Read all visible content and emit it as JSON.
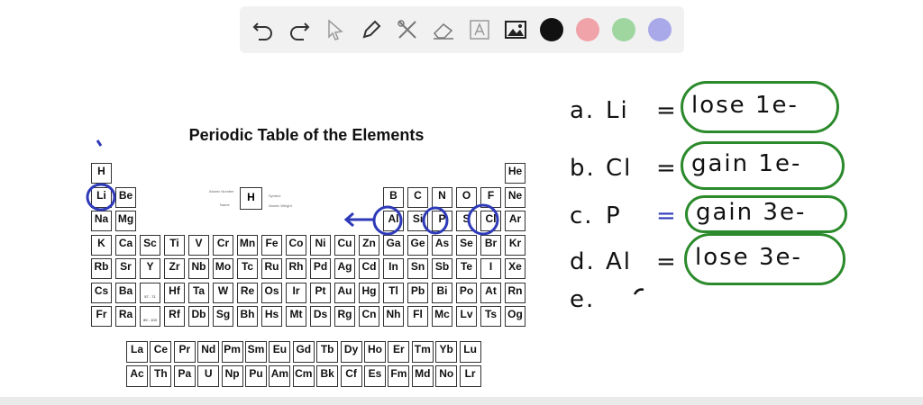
{
  "toolbar": {
    "tools": [
      "undo-icon",
      "redo-icon",
      "pointer-icon",
      "pen-icon",
      "tools-icon",
      "eraser-icon",
      "text-icon",
      "image-icon"
    ],
    "colors": [
      "#111111",
      "#f0a3a8",
      "#9fd6a0",
      "#a9a9ea"
    ]
  },
  "table": {
    "title": "Periodic Table of the Elements",
    "key": {
      "symbol": "H",
      "notes": [
        "Atomic Number",
        "Name",
        "Symbol",
        "Atomic Weight"
      ]
    },
    "elements": [
      {
        "s": "H",
        "r": 0,
        "c": 0
      },
      {
        "s": "He",
        "r": 0,
        "c": 17
      },
      {
        "s": "Li",
        "r": 1,
        "c": 0
      },
      {
        "s": "Be",
        "r": 1,
        "c": 1
      },
      {
        "s": "B",
        "r": 1,
        "c": 12
      },
      {
        "s": "C",
        "r": 1,
        "c": 13
      },
      {
        "s": "N",
        "r": 1,
        "c": 14
      },
      {
        "s": "O",
        "r": 1,
        "c": 15
      },
      {
        "s": "F",
        "r": 1,
        "c": 16
      },
      {
        "s": "Ne",
        "r": 1,
        "c": 17
      },
      {
        "s": "Na",
        "r": 2,
        "c": 0
      },
      {
        "s": "Mg",
        "r": 2,
        "c": 1
      },
      {
        "s": "Al",
        "r": 2,
        "c": 12
      },
      {
        "s": "Si",
        "r": 2,
        "c": 13
      },
      {
        "s": "P",
        "r": 2,
        "c": 14
      },
      {
        "s": "S",
        "r": 2,
        "c": 15
      },
      {
        "s": "Cl",
        "r": 2,
        "c": 16
      },
      {
        "s": "Ar",
        "r": 2,
        "c": 17
      },
      {
        "s": "K",
        "r": 3,
        "c": 0
      },
      {
        "s": "Ca",
        "r": 3,
        "c": 1
      },
      {
        "s": "Sc",
        "r": 3,
        "c": 2
      },
      {
        "s": "Ti",
        "r": 3,
        "c": 3
      },
      {
        "s": "V",
        "r": 3,
        "c": 4
      },
      {
        "s": "Cr",
        "r": 3,
        "c": 5
      },
      {
        "s": "Mn",
        "r": 3,
        "c": 6
      },
      {
        "s": "Fe",
        "r": 3,
        "c": 7
      },
      {
        "s": "Co",
        "r": 3,
        "c": 8
      },
      {
        "s": "Ni",
        "r": 3,
        "c": 9
      },
      {
        "s": "Cu",
        "r": 3,
        "c": 10
      },
      {
        "s": "Zn",
        "r": 3,
        "c": 11
      },
      {
        "s": "Ga",
        "r": 3,
        "c": 12
      },
      {
        "s": "Ge",
        "r": 3,
        "c": 13
      },
      {
        "s": "As",
        "r": 3,
        "c": 14
      },
      {
        "s": "Se",
        "r": 3,
        "c": 15
      },
      {
        "s": "Br",
        "r": 3,
        "c": 16
      },
      {
        "s": "Kr",
        "r": 3,
        "c": 17
      },
      {
        "s": "Rb",
        "r": 4,
        "c": 0
      },
      {
        "s": "Sr",
        "r": 4,
        "c": 1
      },
      {
        "s": "Y",
        "r": 4,
        "c": 2
      },
      {
        "s": "Zr",
        "r": 4,
        "c": 3
      },
      {
        "s": "Nb",
        "r": 4,
        "c": 4
      },
      {
        "s": "Mo",
        "r": 4,
        "c": 5
      },
      {
        "s": "Tc",
        "r": 4,
        "c": 6
      },
      {
        "s": "Ru",
        "r": 4,
        "c": 7
      },
      {
        "s": "Rh",
        "r": 4,
        "c": 8
      },
      {
        "s": "Pd",
        "r": 4,
        "c": 9
      },
      {
        "s": "Ag",
        "r": 4,
        "c": 10
      },
      {
        "s": "Cd",
        "r": 4,
        "c": 11
      },
      {
        "s": "In",
        "r": 4,
        "c": 12
      },
      {
        "s": "Sn",
        "r": 4,
        "c": 13
      },
      {
        "s": "Sb",
        "r": 4,
        "c": 14
      },
      {
        "s": "Te",
        "r": 4,
        "c": 15
      },
      {
        "s": "I",
        "r": 4,
        "c": 16
      },
      {
        "s": "Xe",
        "r": 4,
        "c": 17
      },
      {
        "s": "Cs",
        "r": 5,
        "c": 0
      },
      {
        "s": "Ba",
        "r": 5,
        "c": 1
      },
      {
        "s": "57 - 71",
        "r": 5,
        "c": 2
      },
      {
        "s": "Hf",
        "r": 5,
        "c": 3
      },
      {
        "s": "Ta",
        "r": 5,
        "c": 4
      },
      {
        "s": "W",
        "r": 5,
        "c": 5
      },
      {
        "s": "Re",
        "r": 5,
        "c": 6
      },
      {
        "s": "Os",
        "r": 5,
        "c": 7
      },
      {
        "s": "Ir",
        "r": 5,
        "c": 8
      },
      {
        "s": "Pt",
        "r": 5,
        "c": 9
      },
      {
        "s": "Au",
        "r": 5,
        "c": 10
      },
      {
        "s": "Hg",
        "r": 5,
        "c": 11
      },
      {
        "s": "Tl",
        "r": 5,
        "c": 12
      },
      {
        "s": "Pb",
        "r": 5,
        "c": 13
      },
      {
        "s": "Bi",
        "r": 5,
        "c": 14
      },
      {
        "s": "Po",
        "r": 5,
        "c": 15
      },
      {
        "s": "At",
        "r": 5,
        "c": 16
      },
      {
        "s": "Rn",
        "r": 5,
        "c": 17
      },
      {
        "s": "Fr",
        "r": 6,
        "c": 0
      },
      {
        "s": "Ra",
        "r": 6,
        "c": 1
      },
      {
        "s": "89 - 103",
        "r": 6,
        "c": 2
      },
      {
        "s": "Rf",
        "r": 6,
        "c": 3
      },
      {
        "s": "Db",
        "r": 6,
        "c": 4
      },
      {
        "s": "Sg",
        "r": 6,
        "c": 5
      },
      {
        "s": "Bh",
        "r": 6,
        "c": 6
      },
      {
        "s": "Hs",
        "r": 6,
        "c": 7
      },
      {
        "s": "Mt",
        "r": 6,
        "c": 8
      },
      {
        "s": "Ds",
        "r": 6,
        "c": 9
      },
      {
        "s": "Rg",
        "r": 6,
        "c": 10
      },
      {
        "s": "Cn",
        "r": 6,
        "c": 11
      },
      {
        "s": "Nh",
        "r": 6,
        "c": 12
      },
      {
        "s": "Fl",
        "r": 6,
        "c": 13
      },
      {
        "s": "Mc",
        "r": 6,
        "c": 14
      },
      {
        "s": "Lv",
        "r": 6,
        "c": 15
      },
      {
        "s": "Ts",
        "r": 6,
        "c": 16
      },
      {
        "s": "Og",
        "r": 6,
        "c": 17
      }
    ],
    "lanthanides": [
      "La",
      "Ce",
      "Pr",
      "Nd",
      "Pm",
      "Sm",
      "Eu",
      "Gd",
      "Tb",
      "Dy",
      "Ho",
      "Er",
      "Tm",
      "Yb",
      "Lu"
    ],
    "actinides": [
      "Ac",
      "Th",
      "Pa",
      "U",
      "Np",
      "Pu",
      "Am",
      "Cm",
      "Bk",
      "Cf",
      "Es",
      "Fm",
      "Md",
      "No",
      "Lr"
    ],
    "circled": [
      "Li",
      "Al",
      "P",
      "Cl"
    ]
  },
  "answers": [
    {
      "label": "a.",
      "symbol": "Li",
      "eq": "=",
      "eq_color": "#111111",
      "answer": "lose 1e-"
    },
    {
      "label": "b.",
      "symbol": "Cl",
      "eq": "=",
      "eq_color": "#111111",
      "answer": "gain 1e-"
    },
    {
      "label": "c.",
      "symbol": "P",
      "eq": "=",
      "eq_color": "#2e3ab8",
      "answer": "gain 3e-"
    },
    {
      "label": "d.",
      "symbol": "Al",
      "eq": "=",
      "eq_color": "#111111",
      "answer": "lose 3e-"
    },
    {
      "label": "e.",
      "symbol": "",
      "eq": "",
      "eq_color": "#111111",
      "answer": ""
    }
  ],
  "colors": {
    "ink_blue": "#2e3ab8",
    "ink_green": "#2b8a2b"
  }
}
